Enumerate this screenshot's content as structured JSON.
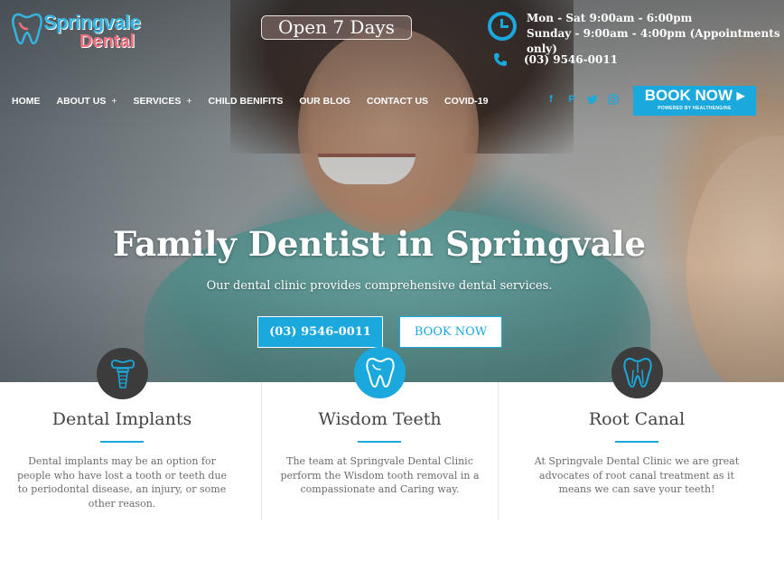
{
  "brand": {
    "name_line1": "Springvale",
    "name_line2": "Dental",
    "primary_color": "#1aa8dd",
    "secondary_color": "#f26f7d"
  },
  "topbar": {
    "open_badge": "Open 7 Days",
    "hours_line1": "Mon - Sat 9:00am - 6:00pm",
    "hours_line2": "Sunday - 9:00am - 4:00pm (Appointments only)",
    "phone": "(03) 9546-0011",
    "clock_icon": "clock-icon",
    "phone_icon": "phone-icon"
  },
  "nav": {
    "items": [
      {
        "label": "HOME",
        "has_submenu": false
      },
      {
        "label": "ABOUT US",
        "has_submenu": true
      },
      {
        "label": "SERVICES",
        "has_submenu": true
      },
      {
        "label": "CHILD BENIFITS",
        "has_submenu": false
      },
      {
        "label": "OUR BLOG",
        "has_submenu": false
      },
      {
        "label": "CONTACT US",
        "has_submenu": false
      },
      {
        "label": "COVID-19",
        "has_submenu": false
      }
    ],
    "submenu_symbol": "+",
    "socials": [
      "facebook-icon",
      "pinterest-icon",
      "twitter-icon",
      "instagram-icon"
    ],
    "book_button": {
      "label": "BOOK NOW",
      "sublabel": "POWERED BY HEALTHENGINE"
    }
  },
  "hero": {
    "title": "Family Dentist in Springvale",
    "subtitle": "Our dental clinic provides comprehensive dental services.",
    "phone_button": "(03) 9546-0011",
    "book_button": "BOOK NOW"
  },
  "services": [
    {
      "title": "Dental Implants",
      "icon": "implant-icon",
      "active": false,
      "text": "Dental implants may be an option for people who have lost a tooth or teeth due to periodontal disease, an injury, or some other reason."
    },
    {
      "title": "Wisdom Teeth",
      "icon": "wisdom-tooth-icon",
      "active": true,
      "text": "The team at Springvale Dental Clinic perform the Wisdom tooth removal in a compassionate and Caring way."
    },
    {
      "title": "Root Canal",
      "icon": "root-canal-icon",
      "active": false,
      "text": "At Springvale Dental Clinic we are great advocates of root canal treatment as it means we can save your teeth!"
    }
  ]
}
